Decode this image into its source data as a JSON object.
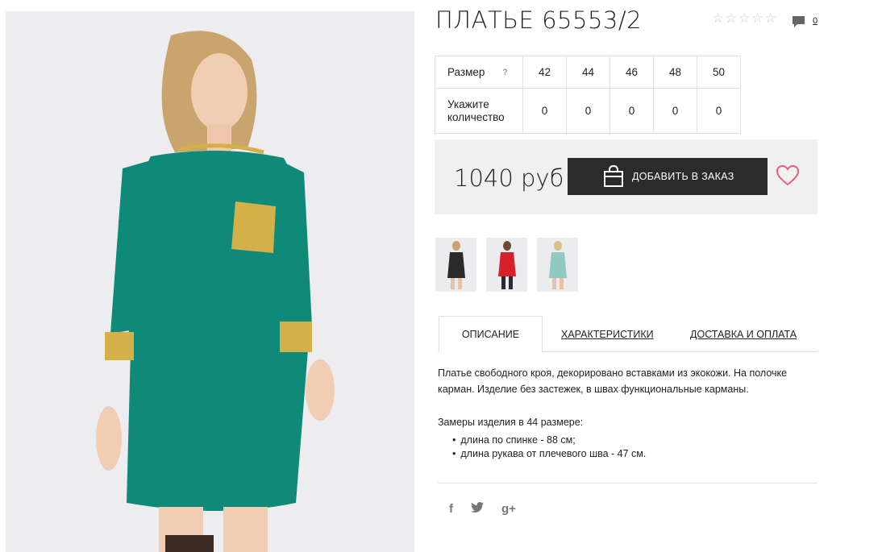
{
  "product": {
    "title": "ПЛАТЬЕ 65553/2",
    "comment_count": "0"
  },
  "sizes": {
    "size_label": "Размер",
    "help_mark": "?",
    "values": [
      "42",
      "44",
      "46",
      "48",
      "50"
    ],
    "qty_label_line1": "Укажите",
    "qty_label_line2": "количество",
    "qty_values": [
      "0",
      "0",
      "0",
      "0",
      "0"
    ]
  },
  "buy": {
    "price": "1040 руб",
    "add_label": "ДОБАВИТЬ В ЗАКАЗ"
  },
  "tabs": {
    "description": "ОПИСАНИЕ",
    "characteristics": "ХАРАКТЕРИСТИКИ",
    "delivery": "ДОСТАВКА И ОПЛАТА"
  },
  "description": {
    "text": "Платье свободного кроя, декорировано вставками из экокожи. На полочке карман. Изделие без застежек, в швах функциональные карманы.",
    "measures_title": "Замеры изделия в 44 размере:",
    "measures": [
      "длина по спинке - 88 см;",
      "длина рукава от плечевого шва - 47 см."
    ]
  },
  "social": {
    "facebook": "f",
    "twitter": "t",
    "gplus": "g+"
  },
  "colors": {
    "dress": "#0f8a78",
    "gold": "#d4b04a",
    "button": "#2b2b2b",
    "heart": "#e0607e"
  },
  "icons": [
    "star-icon",
    "comment-icon",
    "bag-icon",
    "heart-icon",
    "facebook-icon",
    "twitter-icon",
    "gplus-icon"
  ]
}
